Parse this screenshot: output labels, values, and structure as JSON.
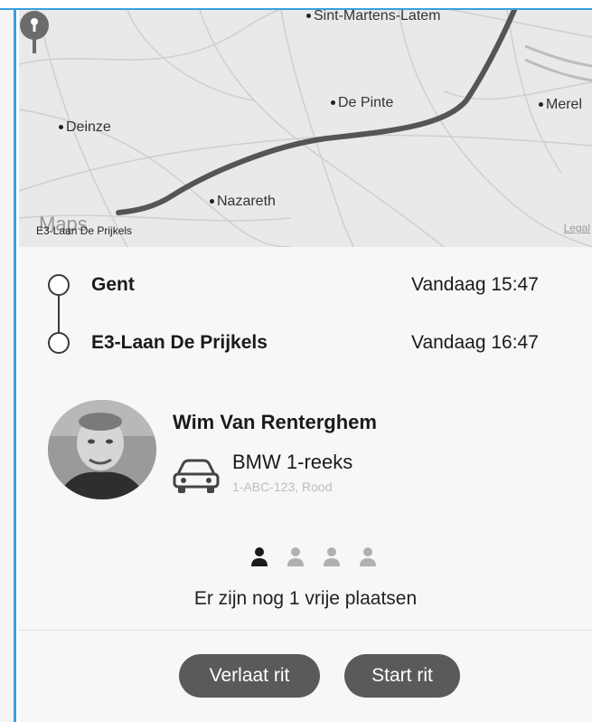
{
  "map": {
    "place_labels": [
      "Sint-Martens-Latem",
      "De Pinte",
      "Merel",
      "Deinze",
      "Nazareth"
    ],
    "pin_label": "E3-Laan De Prijkels",
    "maps_logo": "Maps",
    "legal": "Legal"
  },
  "route": {
    "from": {
      "name": "Gent",
      "time": "Vandaag 15:47"
    },
    "to": {
      "name": "E3-Laan De Prijkels",
      "time": "Vandaag 16:47"
    }
  },
  "driver": {
    "name": "Wim Van Renterghem",
    "car_model": "BMW 1-reeks",
    "car_detail": "1-ABC-123, Rood",
    "avatar_icon": "person-photo",
    "car_icon": "car-icon"
  },
  "seats": {
    "total": 4,
    "occupied": 1,
    "text": "Er zijn nog 1 vrije plaatsen",
    "occupied_color": "#1a1a1a",
    "free_color": "#b0b0b0"
  },
  "actions": {
    "leave_label": "Verlaat rit",
    "start_label": "Start rit"
  },
  "colors": {
    "frame_accent": "#3aa0dc",
    "button_bg": "#5a5a5a",
    "route_line": "#555555"
  }
}
